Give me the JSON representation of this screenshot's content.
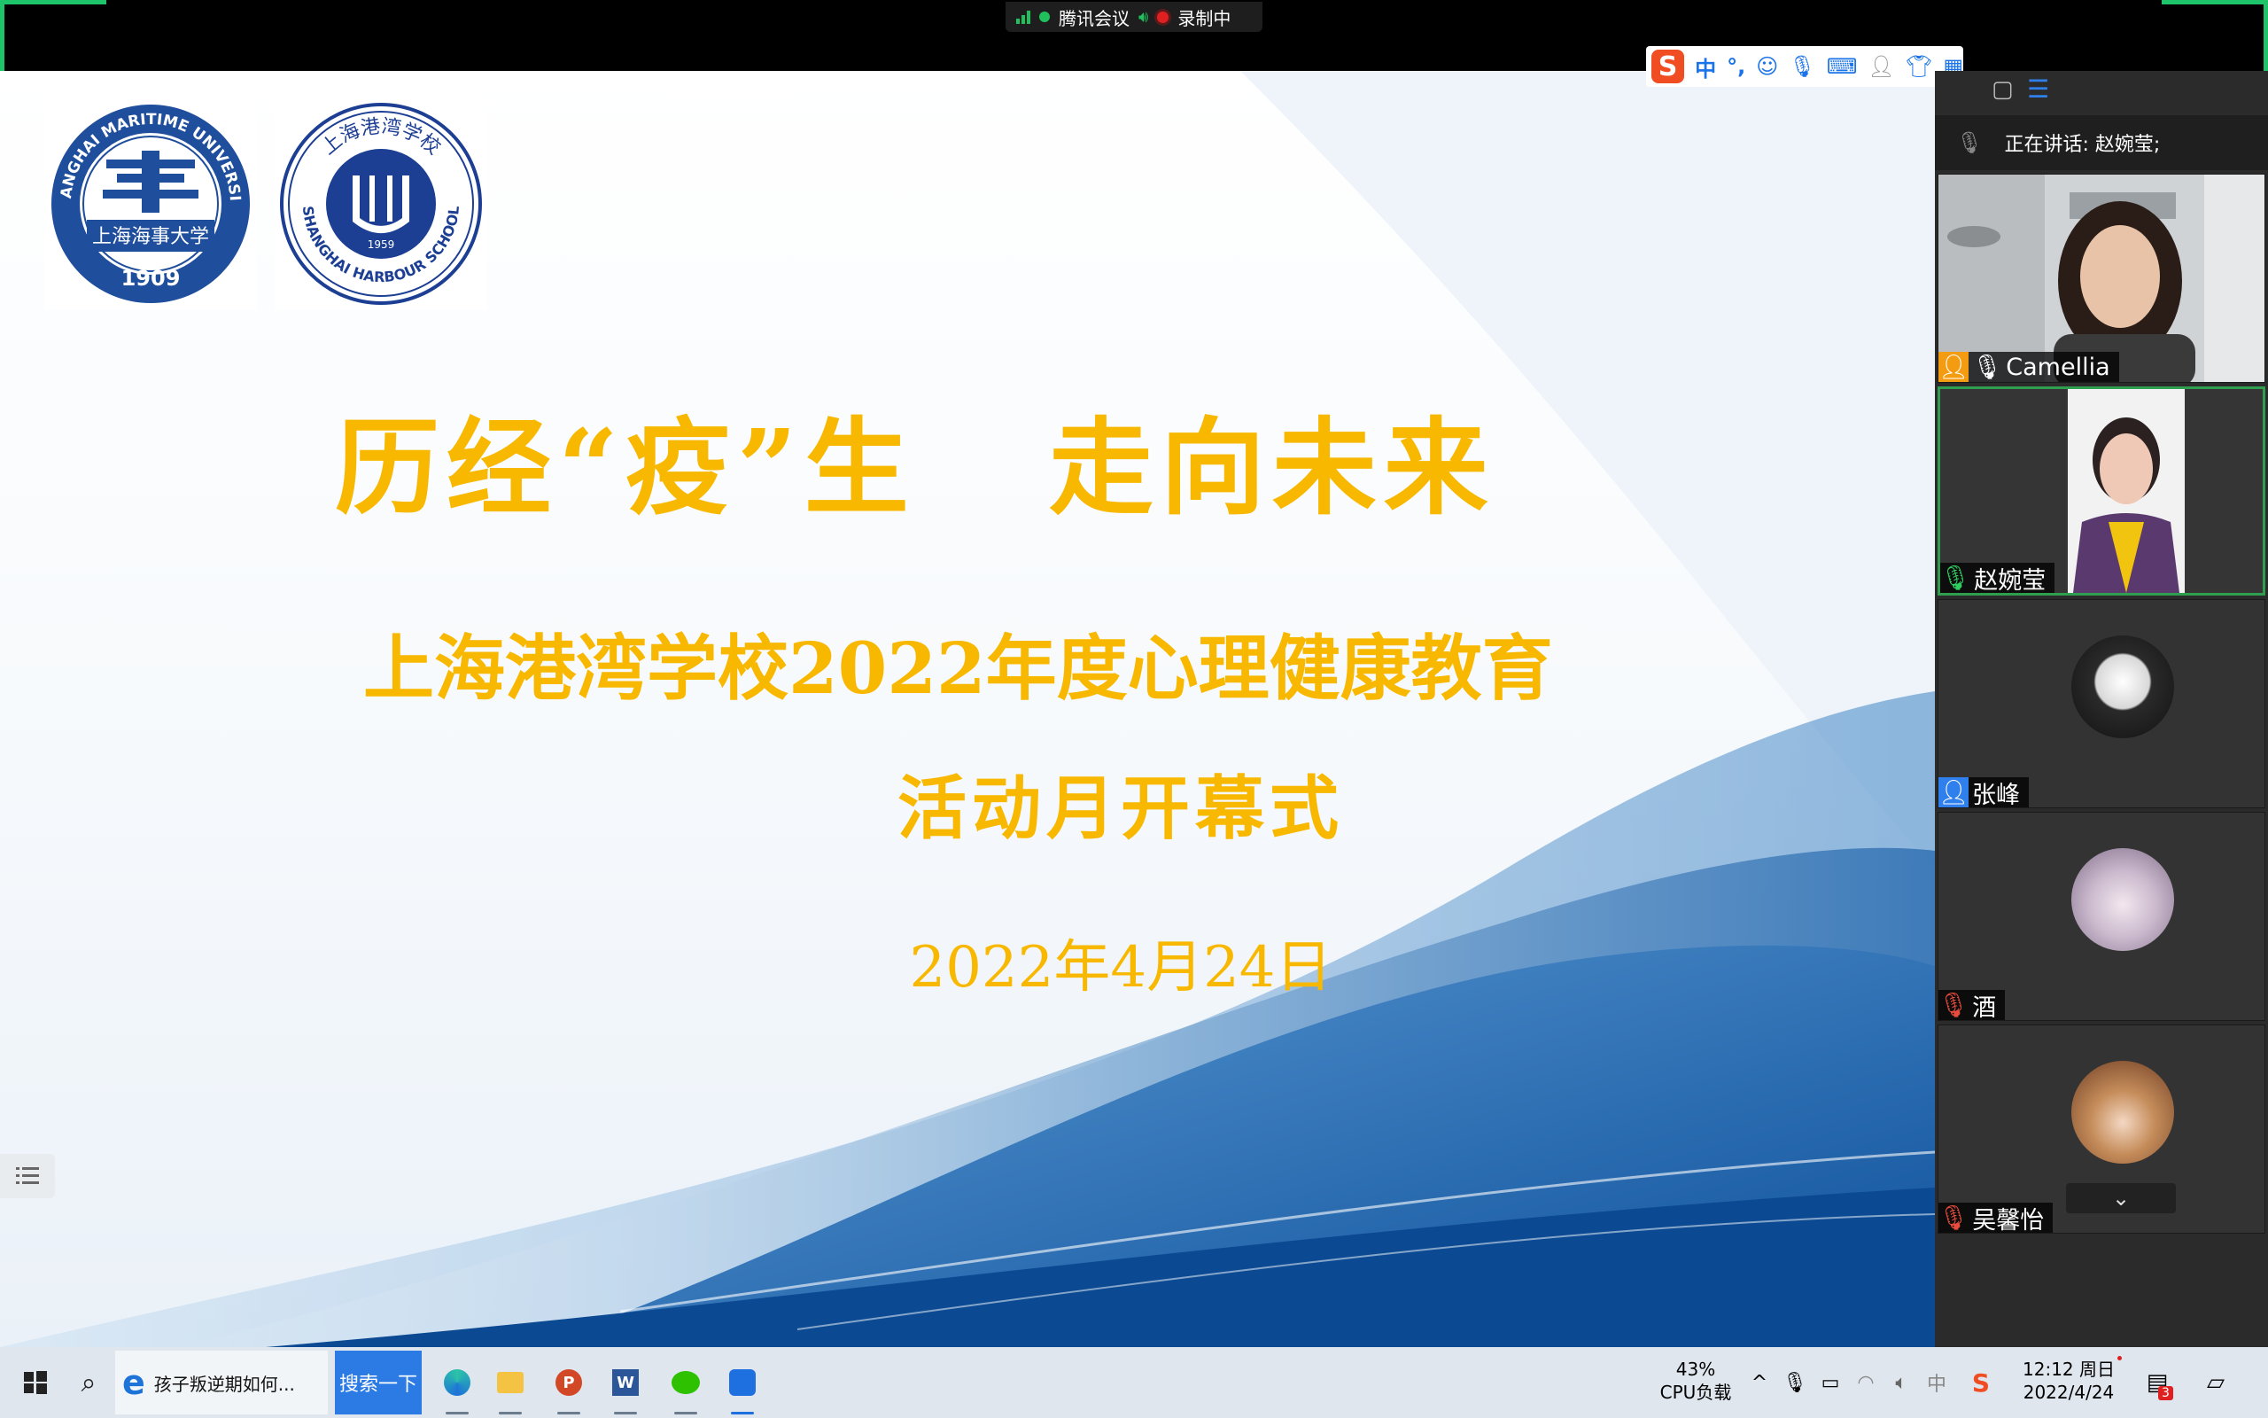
{
  "meeting_status": {
    "app": "腾讯会议",
    "recording": "录制中"
  },
  "slide": {
    "title_part1": "历经“疫”生",
    "title_part2": "走向未来",
    "subtitle_line1": "上海港湾学校2022年度心理健康教育",
    "subtitle_line2": "活动月开幕式",
    "date": "2022年4月24日",
    "logo1": {
      "ring_text": "SHANGHAI MARITIME UNIVERSITY",
      "name": "上海海事大学",
      "year": "1909"
    },
    "logo2": {
      "ring_text_top": "上海港湾学校",
      "ring_text": "SHANGHAI HARBOUR SCHOOL",
      "year": "1959"
    }
  },
  "ime": {
    "mode": "中",
    "punct": "°,"
  },
  "sidebar": {
    "speaking": "正在讲话: 赵婉莹;",
    "participants": [
      {
        "name": "Camellia"
      },
      {
        "name": "赵婉莹"
      },
      {
        "name": "张峰"
      },
      {
        "name": "酒"
      },
      {
        "name": "吴馨怡"
      }
    ]
  },
  "taskbar": {
    "browser_tab": "孩子叛逆期如何...",
    "search_button": "搜索一下",
    "cpu_percent": "43%",
    "cpu_label": "CPU负载",
    "ime_indicator": "中",
    "time": "12:12 周日",
    "date": "2022/4/24",
    "notification_count": "3"
  },
  "colors": {
    "title": "#f8b800",
    "accent_green": "#1ec46a",
    "speaking_border": "#2f9e4f"
  }
}
